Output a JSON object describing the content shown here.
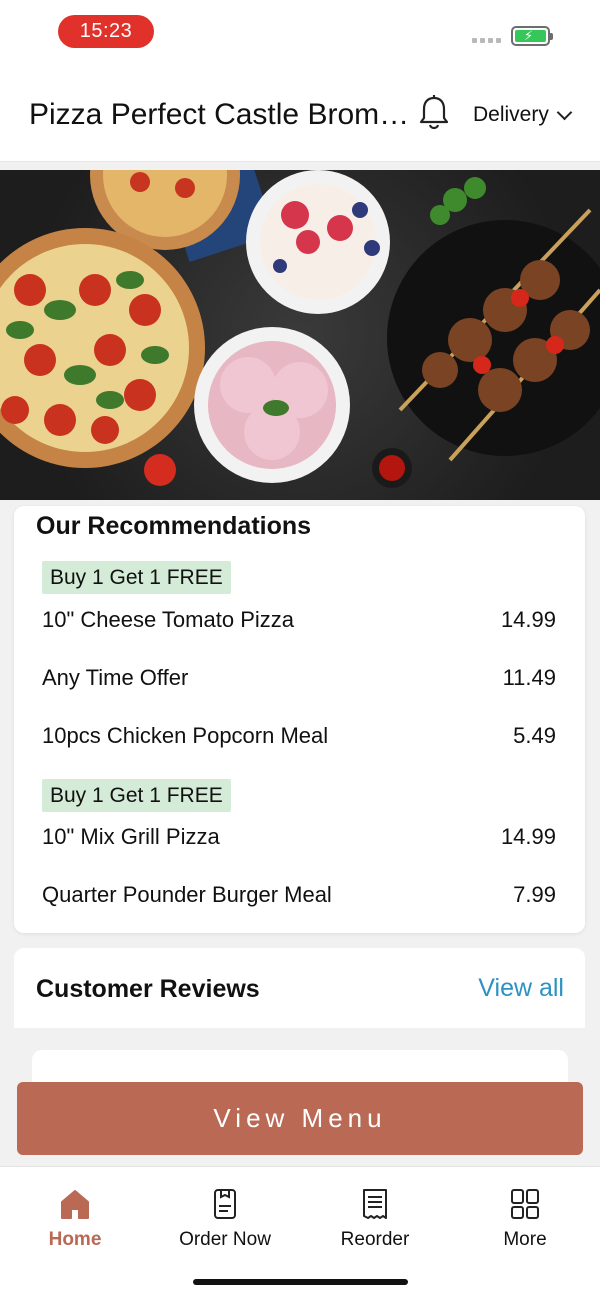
{
  "status": {
    "time": "15:23"
  },
  "header": {
    "store_name": "Pizza Perfect Castle Brom…",
    "mode": "Delivery"
  },
  "recommendations": {
    "title": "Our Recommendations",
    "items": [
      {
        "badge": "Buy 1 Get 1 FREE",
        "name": "10\" Cheese Tomato Pizza",
        "price": "14.99"
      },
      {
        "badge": "",
        "name": "Any Time Offer",
        "price": "11.49"
      },
      {
        "badge": "",
        "name": "10pcs Chicken Popcorn Meal",
        "price": "5.49"
      },
      {
        "badge": "Buy 1 Get 1 FREE",
        "name": "10\" Mix Grill Pizza",
        "price": "14.99"
      },
      {
        "badge": "",
        "name": "Quarter Pounder Burger Meal",
        "price": "7.99"
      }
    ]
  },
  "reviews": {
    "title": "Customer Reviews",
    "view_all": "View all"
  },
  "cta": {
    "label": "View Menu"
  },
  "tabs": [
    {
      "label": "Home",
      "icon": "home-icon",
      "active": true
    },
    {
      "label": "Order Now",
      "icon": "order-icon",
      "active": false
    },
    {
      "label": "Reorder",
      "icon": "receipt-icon",
      "active": false
    },
    {
      "label": "More",
      "icon": "grid-icon",
      "active": false
    }
  ],
  "colors": {
    "accent": "#b96954",
    "link": "#2b92c3",
    "badge_bg": "#d4ecd7",
    "time_pill": "#e0312b"
  }
}
